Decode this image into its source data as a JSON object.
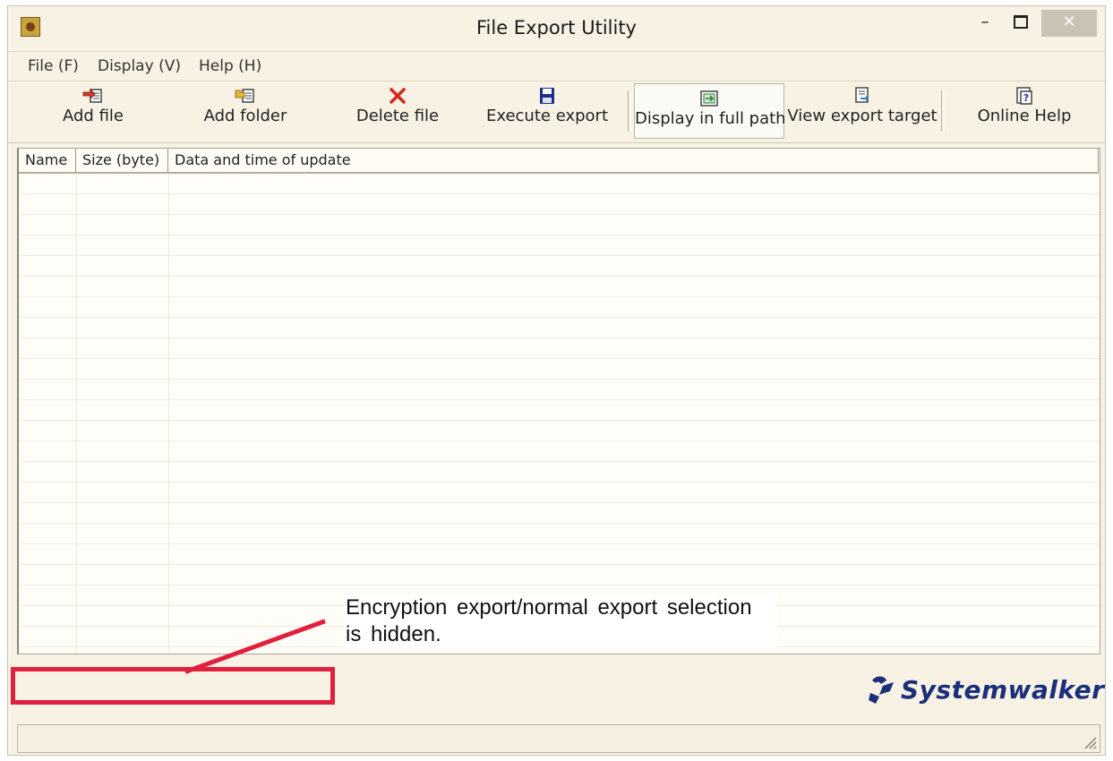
{
  "window": {
    "title": "File Export Utility"
  },
  "window_controls": {
    "minimize": "–",
    "close": "✕"
  },
  "menu": [
    "File (F)",
    "Display (V)",
    "Help (H)"
  ],
  "toolbar": {
    "add_file": "Add file",
    "add_folder": "Add folder",
    "delete_file": "Delete file",
    "execute_export": "Execute export",
    "display_full_path": "Display in full path",
    "view_export_target": "View export target",
    "online_help": "Online Help"
  },
  "icons": {
    "add_file": "add-file-icon",
    "add_folder": "add-folder-icon",
    "delete_file": "delete-x-icon",
    "execute_export": "floppy-disk-icon",
    "display_full_path": "full-path-icon",
    "view_export_target": "view-target-icon",
    "online_help": "help-book-icon"
  },
  "list": {
    "columns": [
      "Name",
      "Size (byte)",
      "Data and time of update"
    ],
    "rows": []
  },
  "logo": {
    "text": "Systemwalker"
  },
  "annotation": {
    "text": "Encryption export/normal export selection is hidden."
  },
  "colors": {
    "annotation": "#e0203e",
    "logo": "#1b2f7a",
    "window_bg": "#f7f2e4"
  }
}
